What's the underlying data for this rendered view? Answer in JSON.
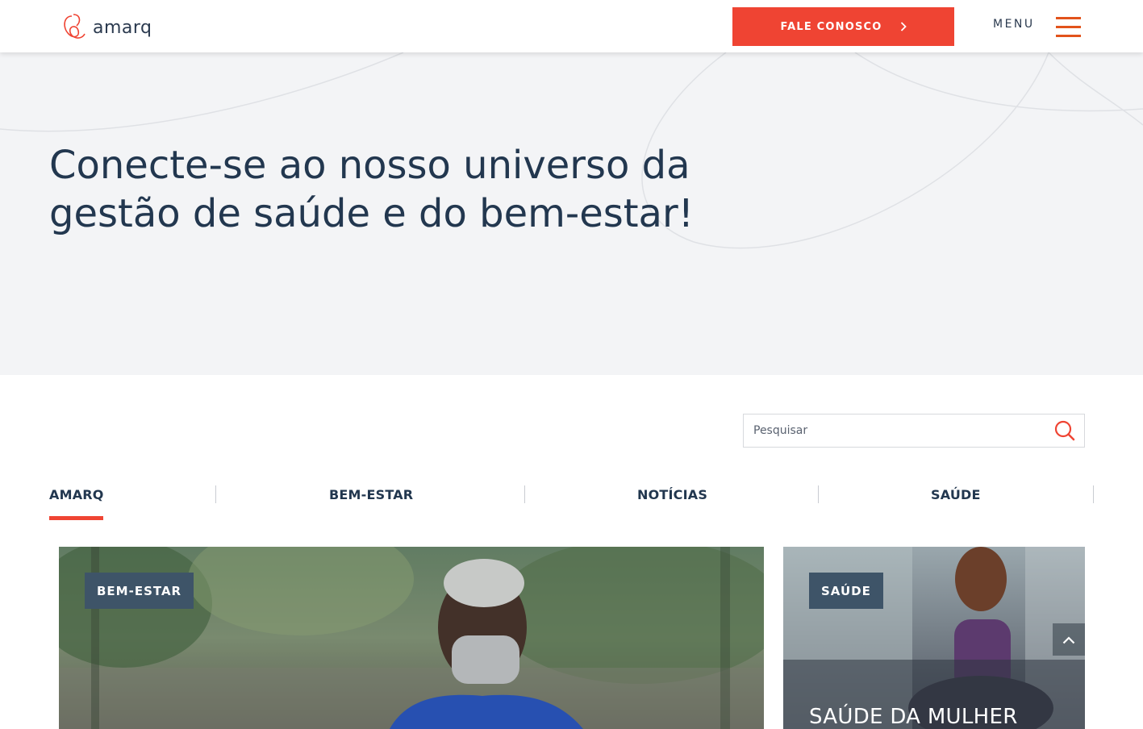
{
  "header": {
    "logo_text": "amarq",
    "cta_label": "FALE CONOSCO",
    "menu_label": "MENU",
    "accent_color": "#ef4433"
  },
  "hero": {
    "title": "Conecte-se ao nosso universo da gestão de saúde e do bem-estar!"
  },
  "search": {
    "placeholder": "Pesquisar",
    "value": ""
  },
  "tabs": [
    {
      "label": "AMARQ",
      "active": true
    },
    {
      "label": "BEM-ESTAR",
      "active": false
    },
    {
      "label": "NOTÍCIAS",
      "active": false
    },
    {
      "label": "SAÚDE",
      "active": false
    }
  ],
  "cards": [
    {
      "tag": "BEM-ESTAR",
      "title": ""
    },
    {
      "tag": "SAÚDE",
      "title": "SAÚDE DA MULHER"
    }
  ],
  "icons": {
    "cta": "chevron-right-icon",
    "menu": "hamburger-icon",
    "search": "search-icon",
    "scroll": "chevron-up-icon"
  }
}
